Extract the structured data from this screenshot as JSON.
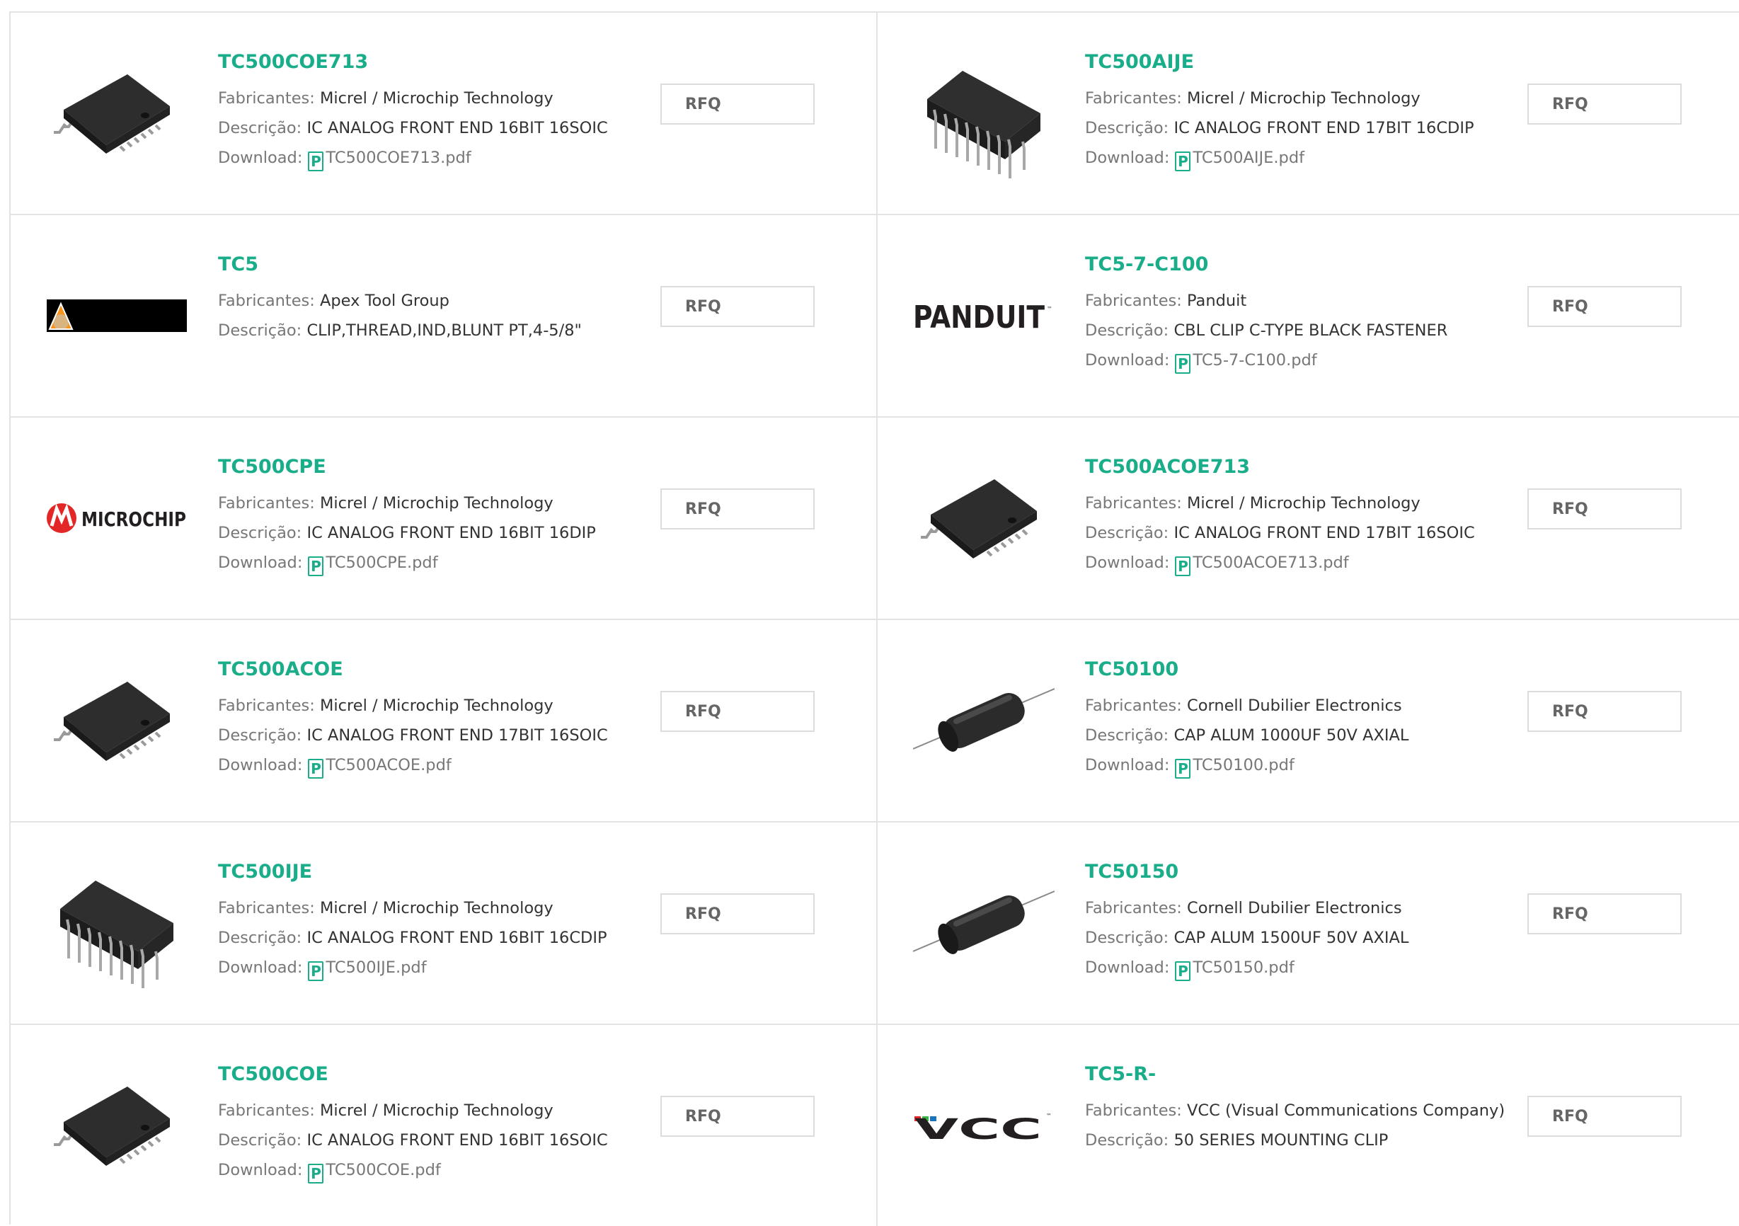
{
  "labels": {
    "manufacturer": "Fabricantes:",
    "description": "Descrição:",
    "download": "Download:",
    "rfq": "RFQ",
    "pdf_glyph": "P"
  },
  "colors": {
    "accent": "#1aad8a",
    "label": "#777777",
    "value": "#333333",
    "border": "#e3e3e3"
  },
  "items": [
    {
      "pn": "TC500COE713",
      "manufacturer": "Micrel / Microchip Technology",
      "description": "IC ANALOG FRONT END 16BIT 16SOIC",
      "pdf": "TC500COE713.pdf",
      "image": "soic-chip"
    },
    {
      "pn": "TC500AIJE",
      "manufacturer": "Micrel / Microchip Technology",
      "description": "IC ANALOG FRONT END 17BIT 16CDIP",
      "pdf": "TC500AIJE.pdf",
      "image": "dip-chip"
    },
    {
      "pn": "TC5",
      "manufacturer": "Apex Tool Group",
      "description": "CLIP,THREAD,IND,BLUNT PT,4-5/8\"",
      "pdf": null,
      "image": "apex-logo"
    },
    {
      "pn": "TC5-7-C100",
      "manufacturer": "Panduit",
      "description": "CBL CLIP C-TYPE BLACK FASTENER",
      "pdf": "TC5-7-C100.pdf",
      "image": "panduit-logo",
      "logo_text": "PANDUIT"
    },
    {
      "pn": "TC500CPE",
      "manufacturer": "Micrel / Microchip Technology",
      "description": "IC ANALOG FRONT END 16BIT 16DIP",
      "pdf": "TC500CPE.pdf",
      "image": "microchip-logo",
      "logo_text": "MICROCHIP"
    },
    {
      "pn": "TC500ACOE713",
      "manufacturer": "Micrel / Microchip Technology",
      "description": "IC ANALOG FRONT END 17BIT 16SOIC",
      "pdf": "TC500ACOE713.pdf",
      "image": "soic-chip"
    },
    {
      "pn": "TC500ACOE",
      "manufacturer": "Micrel / Microchip Technology",
      "description": "IC ANALOG FRONT END 17BIT 16SOIC",
      "pdf": "TC500ACOE.pdf",
      "image": "soic-chip"
    },
    {
      "pn": "TC50100",
      "manufacturer": "Cornell Dubilier Electronics",
      "description": "CAP ALUM 1000UF 50V AXIAL",
      "pdf": "TC50100.pdf",
      "image": "axial-capacitor"
    },
    {
      "pn": "TC500IJE",
      "manufacturer": "Micrel / Microchip Technology",
      "description": "IC ANALOG FRONT END 16BIT 16CDIP",
      "pdf": "TC500IJE.pdf",
      "image": "dip-chip"
    },
    {
      "pn": "TC50150",
      "manufacturer": "Cornell Dubilier Electronics",
      "description": "CAP ALUM 1500UF 50V AXIAL",
      "pdf": "TC50150.pdf",
      "image": "axial-capacitor"
    },
    {
      "pn": "TC500COE",
      "manufacturer": "Micrel / Microchip Technology",
      "description": "IC ANALOG FRONT END 16BIT 16SOIC",
      "pdf": "TC500COE.pdf",
      "image": "soic-chip"
    },
    {
      "pn": "TC5-R-",
      "manufacturer": "VCC (Visual Communications Company)",
      "description": "50 SERIES MOUNTING CLIP",
      "pdf": null,
      "image": "vcc-logo",
      "logo_text": "VCC"
    }
  ]
}
